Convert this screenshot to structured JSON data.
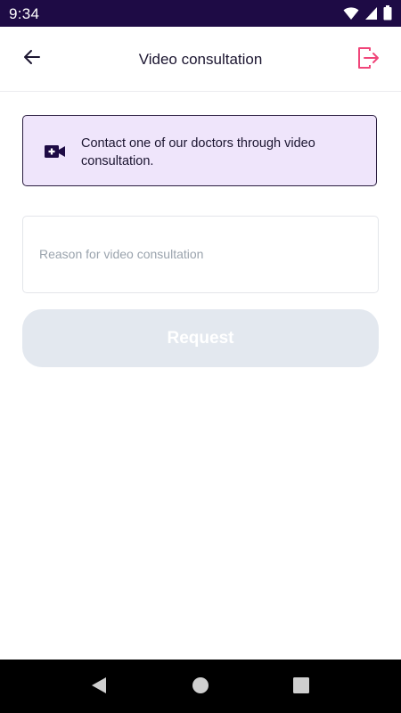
{
  "status_bar": {
    "time": "9:34",
    "icons": [
      "wifi-icon",
      "cell-signal-icon",
      "battery-icon"
    ]
  },
  "app_bar": {
    "title": "Video consultation",
    "back_icon": "arrow-left-icon",
    "logout_icon": "logout-icon"
  },
  "info_card": {
    "icon": "video-plus-icon",
    "text": "Contact one of our doctors through video consultation."
  },
  "reason_field": {
    "placeholder": "Reason for video consultation",
    "value": ""
  },
  "request_button": {
    "label": "Request",
    "enabled": false
  },
  "nav_bar": {
    "icons": [
      "back-triangle-icon",
      "home-circle-icon",
      "recents-square-icon"
    ]
  },
  "colors": {
    "status_bar": "#1e0b45",
    "accent": "#f0467a",
    "card_bg": "#efe5fb",
    "button_disabled": "#e3e8ef"
  }
}
